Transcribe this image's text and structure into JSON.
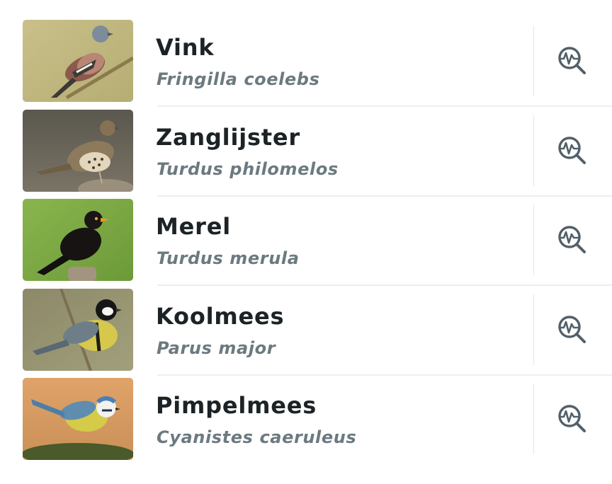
{
  "colors": {
    "title_text": "#1c2326",
    "subtitle_text": "#6c7a80",
    "icon": "#52606a",
    "divider": "#eceef0"
  },
  "birds": [
    {
      "common_name": "Vink",
      "scientific_name": "Fringilla coelebs",
      "action_icon": "search-spectrogram-icon"
    },
    {
      "common_name": "Zanglijster",
      "scientific_name": "Turdus philomelos",
      "action_icon": "search-spectrogram-icon"
    },
    {
      "common_name": "Merel",
      "scientific_name": "Turdus merula",
      "action_icon": "search-spectrogram-icon"
    },
    {
      "common_name": "Koolmees",
      "scientific_name": "Parus major",
      "action_icon": "search-spectrogram-icon"
    },
    {
      "common_name": "Pimpelmees",
      "scientific_name": "Cyanistes caeruleus",
      "action_icon": "search-spectrogram-icon"
    }
  ]
}
